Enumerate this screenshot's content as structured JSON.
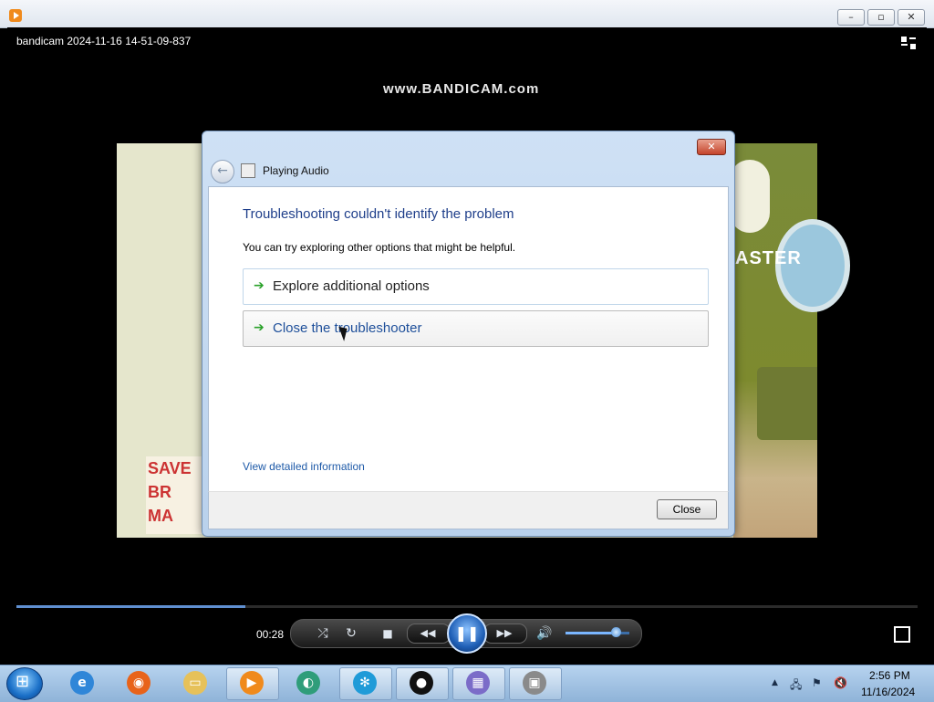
{
  "window": {
    "title": "bandicam 2024-11-16 14-51-09-837",
    "caption_buttons": [
      "–",
      "▫",
      "✕"
    ]
  },
  "video": {
    "watermark": "www.BANDICAM.com",
    "scene_text": "ASTER",
    "logo_text": "SAVE\nBR\nMA"
  },
  "dialog": {
    "title": "Playing Audio",
    "heading": "Troubleshooting couldn't identify the problem",
    "subtext": "You can try exploring other options that might be helpful.",
    "options": [
      {
        "label": "Explore additional options"
      },
      {
        "label": "Close the troubleshooter"
      }
    ],
    "detail_link": "View detailed information",
    "close_button": "Close",
    "close_x": "✕",
    "back_arrow": "←"
  },
  "player": {
    "time": "00:28",
    "seek_fraction": 0.254,
    "volume_fraction": 0.8,
    "controls": {
      "shuffle": "⤮",
      "repeat": "↻",
      "stop": "■",
      "rewind": "◀◀",
      "pause": "❚❚",
      "forward": "▶▶",
      "volume": "🔊"
    }
  },
  "taskbar": {
    "items": [
      {
        "name": "internet-explorer",
        "glyph": "e",
        "color": "#2f86d8",
        "active": false
      },
      {
        "name": "firefox",
        "glyph": "◉",
        "color": "#e8631a",
        "active": false
      },
      {
        "name": "file-explorer",
        "glyph": "▭",
        "color": "#e6c15a",
        "active": false
      },
      {
        "name": "media-player",
        "glyph": "▶",
        "color": "#f08a1c",
        "active": true
      },
      {
        "name": "bandicam-pip",
        "glyph": "◐",
        "color": "#2f9d7a",
        "active": false
      },
      {
        "name": "user-assist",
        "glyph": "✻",
        "color": "#1f9bd8",
        "active": true
      },
      {
        "name": "record",
        "glyph": "●",
        "color": "#111111",
        "active": true
      },
      {
        "name": "movie-maker",
        "glyph": "▦",
        "color": "#7b6cc8",
        "active": true
      },
      {
        "name": "troubleshooter",
        "glyph": "▣",
        "color": "#8a8a8a",
        "active": true
      }
    ],
    "tray": {
      "up_arrow": "▲",
      "network": "🖧",
      "flag": "⚑",
      "volume": "🔇"
    },
    "clock_time": "2:56 PM",
    "clock_date": "11/16/2024"
  }
}
